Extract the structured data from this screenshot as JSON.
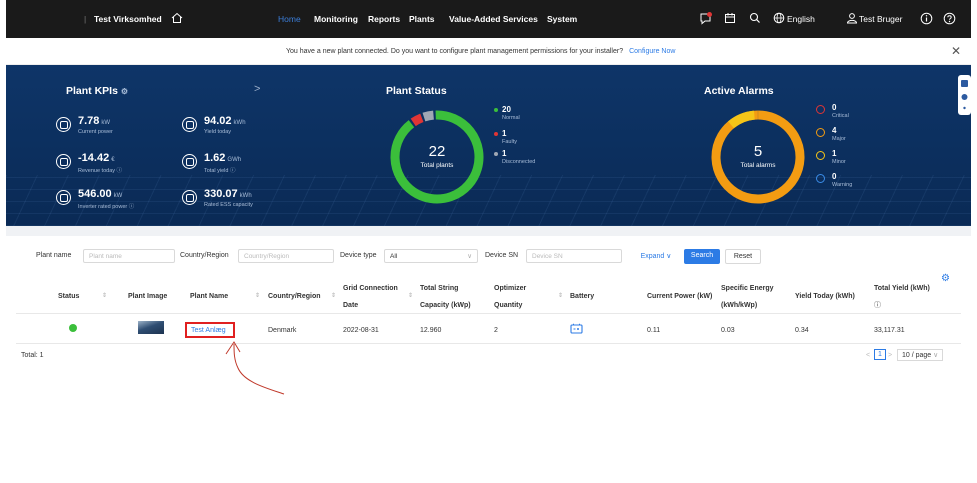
{
  "topbar": {
    "org": "Test Virksomhed",
    "nav": [
      "Home",
      "Monitoring",
      "Reports",
      "Plants",
      "Value-Added Services",
      "System"
    ],
    "language": "English",
    "user": "Test Bruger"
  },
  "notice": {
    "text": "You have a new plant connected. Do you want to configure plant management permissions for your installer?",
    "link": "Configure Now",
    "close": "✕"
  },
  "kpis": {
    "title": "Plant KPIs",
    "items": [
      {
        "value": "7.78",
        "unit": "kW",
        "label": "Current power"
      },
      {
        "value": "94.02",
        "unit": "kWh",
        "label": "Yield today"
      },
      {
        "value": "-14.42",
        "unit": "€",
        "label": "Revenue today"
      },
      {
        "value": "1.62",
        "unit": "GWh",
        "label": "Total yield"
      },
      {
        "value": "546.00",
        "unit": "kW",
        "label": "Inverter rated power"
      },
      {
        "value": "330.07",
        "unit": "kWh",
        "label": "Rated ESS capacity"
      }
    ]
  },
  "plant_status": {
    "title": "Plant Status",
    "total": "22",
    "total_label": "Total plants",
    "legend": [
      {
        "value": "20",
        "label": "Normal",
        "color": "#3bbf3b",
        "count": 20
      },
      {
        "value": "1",
        "label": "Faulty",
        "color": "#e03535",
        "count": 1
      },
      {
        "value": "1",
        "label": "Disconnected",
        "color": "#a0a8b4",
        "count": 1
      }
    ]
  },
  "alarms": {
    "title": "Active Alarms",
    "total": "5",
    "total_label": "Total alarms",
    "legend": [
      {
        "value": "0",
        "label": "Critical",
        "color": "#e03535"
      },
      {
        "value": "4",
        "label": "Major",
        "color": "#f39c12"
      },
      {
        "value": "1",
        "label": "Minor",
        "color": "#f5c518"
      },
      {
        "value": "0",
        "label": "Warning",
        "color": "#3b8de8"
      }
    ]
  },
  "filters": {
    "plant_name_label": "Plant name",
    "plant_name_placeholder": "Plant name",
    "country_label": "Country/Region",
    "country_placeholder": "Country/Region",
    "device_type_label": "Device type",
    "device_type_value": "All",
    "device_sn_label": "Device SN",
    "device_sn_placeholder": "Device SN",
    "expand": "Expand",
    "search": "Search",
    "reset": "Reset"
  },
  "table": {
    "headers": {
      "status": "Status",
      "image": "Plant Image",
      "name": "Plant Name",
      "country": "Country/Region",
      "grid1": "Grid Connection",
      "grid2": "Date",
      "string1": "Total String",
      "string2": "Capacity (kWp)",
      "opt1": "Optimizer",
      "opt2": "Quantity",
      "battery": "Battery",
      "power": "Current Power (kW)",
      "spec1": "Specific Energy",
      "spec2": "(kWh/kWp)",
      "yield_today": "Yield Today (kWh)",
      "total_yield": "Total Yield (kWh)"
    },
    "rows": [
      {
        "name": "Test Anlæg",
        "country": "Denmark",
        "grid_date": "2022-08-31",
        "string_capacity": "12.960",
        "optimizers": "2",
        "current_power": "0.11",
        "specific_energy": "0.03",
        "yield_today": "0.34",
        "total_yield": "33,117.31"
      }
    ],
    "total": "Total: 1",
    "page": "1",
    "page_size": "10 / page"
  }
}
